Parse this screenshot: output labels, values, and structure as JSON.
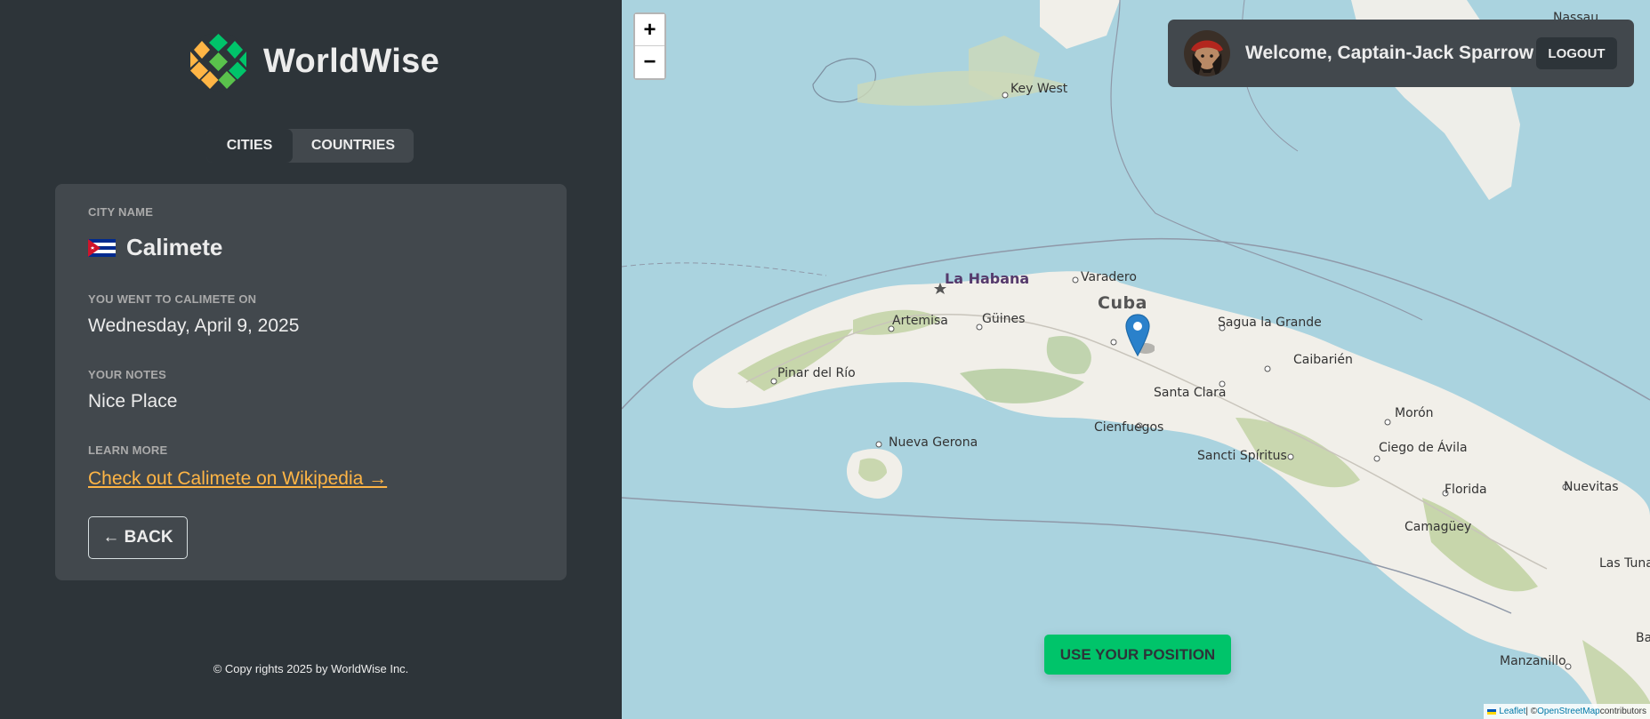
{
  "brand": {
    "name": "WorldWise"
  },
  "tabs": [
    {
      "label": "CITIES",
      "active": true
    },
    {
      "label": "COUNTRIES",
      "active": false
    }
  ],
  "city": {
    "name_label": "CITY NAME",
    "flag": "cuba-flag",
    "name": "Calimete",
    "date_label": "YOU WENT TO CALIMETE ON",
    "date": "Wednesday, April 9, 2025",
    "notes_label": "YOUR NOTES",
    "notes": "Nice Place",
    "learn_label": "LEARN MORE",
    "wiki_link": "Check out Calimete on Wikipedia →",
    "back_label": "← BACK"
  },
  "footer": {
    "text": "© Copy rights 2025 by WorldWise Inc."
  },
  "map": {
    "zoom_in": "+",
    "zoom_out": "−",
    "labels": {
      "key_west": "Key West",
      "la_habana": "La Habana",
      "varadero": "Varadero",
      "cuba": "Cuba",
      "artemisa": "Artemisa",
      "guines": "Güines",
      "sagua": "Sagua la Grande",
      "pinar": "Pinar del Río",
      "caibarien": "Caibarién",
      "santa_clara": "Santa Clara",
      "cienfuegos": "Cienfuegos",
      "nueva_gerona": "Nueva Gerona",
      "sancti": "Sancti Spíritus",
      "moron": "Morón",
      "ciego": "Ciego de Ávila",
      "florida": "Florida",
      "nuevitas": "Nuevitas",
      "camaguey": "Camagüey",
      "las_tunas": "Las Tuna",
      "manzanillo": "Manzanillo",
      "nassau": "Nassau",
      "ba": "Ba"
    },
    "attribution": {
      "leaflet": "Leaflet",
      "sep": " | © ",
      "osm": "OpenStreetMap",
      "suffix": " contributors"
    },
    "use_position": "USE YOUR POSITION"
  },
  "user": {
    "welcome": "Welcome, Captain-Jack Sparrow",
    "logout": "LOGOUT"
  },
  "colors": {
    "accent_green": "#00c46a",
    "accent_orange": "#ffb545",
    "sidebar_bg": "#2d3439",
    "card_bg": "#42484d",
    "marker_blue": "#2a81cb"
  }
}
